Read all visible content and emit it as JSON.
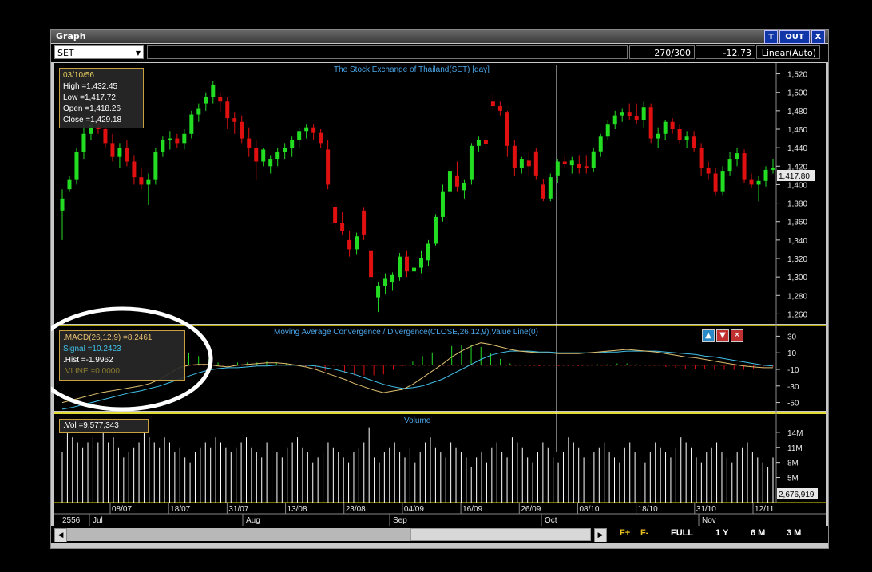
{
  "window": {
    "title": "Graph",
    "btn_t": "T",
    "btn_out": "OUT",
    "btn_x": "X"
  },
  "toolbar": {
    "symbol": "SET",
    "count": "270/300",
    "change": "-12.73",
    "scale": "Linear(Auto)"
  },
  "price_panel": {
    "title": "The Stock Exchange of Thailand(SET) [day]",
    "info": {
      "date": "03/10/56",
      "high": "High  =1,432.45",
      "low": "Low   =1,417.72",
      "open": "Open  =1,418.26",
      "close": "Close  =1,429.18"
    },
    "last_label": "1,417.80",
    "y_ticks": [
      "1,520",
      "1,500",
      "1,480",
      "1,460",
      "1,440",
      "1,420",
      "1,400",
      "1,380",
      "1,360",
      "1,340",
      "1,320",
      "1,300",
      "1,280",
      "1,260"
    ]
  },
  "macd_panel": {
    "title": "Moving Average Convergence / Divergence(CLOSE,26,12,9),Value Line(0)",
    "info": {
      "macd": ".MACD(26,12,9)   =8.2461",
      "signal": "Signal  =10.2423",
      "hist": ".Hist  =-1.9962",
      "vline": ".VLINE   =0.0000"
    },
    "y_ticks": [
      "30",
      "10",
      "-10",
      "-30",
      "-50"
    ]
  },
  "volume_panel": {
    "title": "Volume",
    "info": {
      "vol": ".Vol   =9,577,343"
    },
    "last_label": "2,676,919",
    "y_ticks": [
      "14M",
      "11M",
      "8M",
      "5M"
    ]
  },
  "x_axis": {
    "date_ticks": [
      "08/07",
      "18/07",
      "31/07",
      "13/08",
      "23/08",
      "04/09",
      "16/09",
      "26/09",
      "08/10",
      "18/10",
      "31/10",
      "12/11"
    ],
    "year": "2556",
    "month_ticks": [
      "Jul",
      "Aug",
      "Sep",
      "Oct",
      "Nov"
    ]
  },
  "bottom_bar": {
    "f_plus": "F+",
    "f_minus": "F-",
    "full": "FULL",
    "y1": "1 Y",
    "m6": "6 M",
    "m3": "3 M"
  },
  "colors": {
    "up": "#22dd22",
    "down": "#e01010",
    "macd_line": "#e0c070",
    "signal_line": "#40c0e8",
    "panel_border": "#e8e000",
    "accent": "#e8e000"
  },
  "chart_data": {
    "type": "candlestick",
    "title": "The Stock Exchange of Thailand(SET) [day]",
    "ylim": [
      1250,
      1530
    ],
    "candles": [
      [
        1372,
        1395,
        1340,
        1385
      ],
      [
        1395,
        1410,
        1392,
        1405
      ],
      [
        1405,
        1440,
        1400,
        1435
      ],
      [
        1435,
        1465,
        1428,
        1455
      ],
      [
        1455,
        1470,
        1448,
        1465
      ],
      [
        1465,
        1478,
        1455,
        1460
      ],
      [
        1460,
        1468,
        1440,
        1445
      ],
      [
        1445,
        1455,
        1425,
        1430
      ],
      [
        1430,
        1445,
        1418,
        1440
      ],
      [
        1440,
        1448,
        1420,
        1425
      ],
      [
        1425,
        1432,
        1400,
        1408
      ],
      [
        1408,
        1418,
        1395,
        1400
      ],
      [
        1400,
        1412,
        1378,
        1405
      ],
      [
        1405,
        1440,
        1400,
        1435
      ],
      [
        1435,
        1452,
        1430,
        1448
      ],
      [
        1448,
        1458,
        1438,
        1450
      ],
      [
        1450,
        1455,
        1440,
        1445
      ],
      [
        1445,
        1460,
        1438,
        1455
      ],
      [
        1455,
        1480,
        1450,
        1476
      ],
      [
        1476,
        1488,
        1468,
        1482
      ],
      [
        1488,
        1500,
        1480,
        1495
      ],
      [
        1495,
        1512,
        1488,
        1508
      ],
      [
        1495,
        1500,
        1478,
        1490
      ],
      [
        1490,
        1495,
        1460,
        1472
      ],
      [
        1472,
        1478,
        1455,
        1468
      ],
      [
        1468,
        1475,
        1445,
        1450
      ],
      [
        1450,
        1462,
        1430,
        1440
      ],
      [
        1440,
        1448,
        1405,
        1425
      ],
      [
        1425,
        1440,
        1420,
        1438
      ],
      [
        1420,
        1432,
        1412,
        1428
      ],
      [
        1428,
        1440,
        1420,
        1435
      ],
      [
        1435,
        1445,
        1428,
        1440
      ],
      [
        1440,
        1452,
        1430,
        1448
      ],
      [
        1448,
        1462,
        1440,
        1458
      ],
      [
        1458,
        1465,
        1450,
        1462
      ],
      [
        1462,
        1465,
        1448,
        1456
      ],
      [
        1456,
        1460,
        1440,
        1445
      ],
      [
        1438,
        1448,
        1395,
        1400
      ],
      [
        1376,
        1380,
        1352,
        1358
      ],
      [
        1358,
        1370,
        1345,
        1350
      ],
      [
        1340,
        1350,
        1322,
        1330
      ],
      [
        1330,
        1348,
        1324,
        1344
      ],
      [
        1372,
        1375,
        1340,
        1346
      ],
      [
        1328,
        1332,
        1290,
        1300
      ],
      [
        1278,
        1294,
        1262,
        1290
      ],
      [
        1290,
        1304,
        1282,
        1298
      ],
      [
        1294,
        1305,
        1285,
        1302
      ],
      [
        1300,
        1326,
        1296,
        1322
      ],
      [
        1322,
        1328,
        1300,
        1306
      ],
      [
        1306,
        1312,
        1298,
        1310
      ],
      [
        1310,
        1328,
        1304,
        1320
      ],
      [
        1318,
        1340,
        1312,
        1336
      ],
      [
        1336,
        1368,
        1334,
        1365
      ],
      [
        1365,
        1400,
        1360,
        1392
      ],
      [
        1392,
        1420,
        1388,
        1415
      ],
      [
        1410,
        1425,
        1392,
        1398
      ],
      [
        1394,
        1405,
        1385,
        1402
      ],
      [
        1405,
        1445,
        1400,
        1442
      ],
      [
        1442,
        1452,
        1436,
        1448
      ],
      [
        1448,
        1452,
        1440,
        1444
      ],
      [
        1490,
        1498,
        1480,
        1485
      ],
      [
        1485,
        1490,
        1475,
        1480
      ],
      [
        1478,
        1480,
        1430,
        1442
      ],
      [
        1442,
        1448,
        1410,
        1418
      ],
      [
        1418,
        1430,
        1412,
        1428
      ],
      [
        1426,
        1436,
        1410,
        1420
      ],
      [
        1436,
        1440,
        1405,
        1410
      ],
      [
        1400,
        1406,
        1382,
        1385
      ],
      [
        1385,
        1412,
        1382,
        1408
      ],
      [
        1410,
        1428,
        1402,
        1425
      ],
      [
        1425,
        1432,
        1418,
        1422
      ],
      [
        1421,
        1430,
        1412,
        1426
      ],
      [
        1422,
        1432,
        1412,
        1418
      ],
      [
        1420,
        1432,
        1412,
        1418
      ],
      [
        1418,
        1440,
        1414,
        1436
      ],
      [
        1436,
        1455,
        1430,
        1452
      ],
      [
        1452,
        1470,
        1448,
        1465
      ],
      [
        1465,
        1480,
        1460,
        1475
      ],
      [
        1475,
        1482,
        1468,
        1478
      ],
      [
        1478,
        1488,
        1470,
        1474
      ],
      [
        1474,
        1488,
        1466,
        1470
      ],
      [
        1470,
        1490,
        1462,
        1484
      ],
      [
        1484,
        1488,
        1445,
        1450
      ],
      [
        1450,
        1462,
        1440,
        1455
      ],
      [
        1455,
        1470,
        1448,
        1468
      ],
      [
        1468,
        1472,
        1455,
        1460
      ],
      [
        1460,
        1465,
        1445,
        1448
      ],
      [
        1448,
        1458,
        1440,
        1452
      ],
      [
        1452,
        1458,
        1435,
        1440
      ],
      [
        1440,
        1445,
        1410,
        1418
      ],
      [
        1418,
        1425,
        1405,
        1412
      ],
      [
        1412,
        1418,
        1388,
        1392
      ],
      [
        1392,
        1420,
        1388,
        1415
      ],
      [
        1415,
        1435,
        1410,
        1428
      ],
      [
        1428,
        1440,
        1420,
        1434
      ],
      [
        1434,
        1438,
        1402,
        1405
      ],
      [
        1405,
        1412,
        1396,
        1400
      ],
      [
        1400,
        1410,
        1382,
        1404
      ],
      [
        1404,
        1420,
        1398,
        1416
      ],
      [
        1416,
        1428,
        1412,
        1418
      ]
    ],
    "macd": [
      -50,
      -47,
      -44,
      -41,
      -38,
      -36,
      -34,
      -32,
      -30,
      -27,
      -22,
      -15,
      -8,
      -5,
      -4,
      -4,
      -6,
      -7,
      -5,
      -4,
      -3,
      -2,
      -2,
      -3,
      -5,
      -7,
      -10,
      -14,
      -18,
      -22,
      -27,
      -31,
      -35,
      -38,
      -36,
      -34,
      -28,
      -20,
      -12,
      -4,
      5,
      12,
      18,
      22,
      20,
      17,
      14,
      12,
      11,
      10,
      10,
      9,
      9,
      9,
      10,
      11,
      12,
      13,
      14,
      13,
      12,
      11,
      9,
      7,
      5,
      4,
      2,
      0,
      -2,
      -4,
      -6,
      -7,
      -8,
      -8
    ],
    "signal": [
      -58,
      -56,
      -53,
      -50,
      -47,
      -44,
      -41,
      -38,
      -36,
      -33,
      -30,
      -26,
      -22,
      -18,
      -14,
      -11,
      -9,
      -8,
      -8,
      -7,
      -6,
      -6,
      -5,
      -5,
      -5,
      -5,
      -6,
      -8,
      -10,
      -13,
      -16,
      -20,
      -24,
      -28,
      -31,
      -33,
      -32,
      -30,
      -26,
      -22,
      -16,
      -10,
      -4,
      2,
      7,
      10,
      12,
      12,
      12,
      11,
      11,
      10,
      10,
      10,
      10,
      10,
      11,
      11,
      12,
      12,
      12,
      12,
      11,
      10,
      9,
      8,
      6,
      5,
      3,
      1,
      -1,
      -3,
      -5,
      -6
    ],
    "volume_max": 17.0,
    "volume": [
      10,
      14,
      13,
      12,
      11,
      12,
      13,
      12,
      14,
      12,
      13,
      11,
      9,
      10,
      11,
      12,
      14,
      13,
      12,
      11,
      13,
      12,
      10,
      11,
      9,
      8,
      10,
      11,
      12,
      11,
      13,
      12,
      11,
      10,
      11,
      12,
      13,
      11,
      10,
      9,
      12,
      11,
      10,
      9,
      11,
      12,
      13,
      11,
      10,
      8,
      9,
      10,
      12,
      11,
      10,
      9,
      8,
      10,
      11,
      12,
      15,
      9,
      8,
      10,
      11,
      12,
      10,
      9,
      11,
      8,
      10,
      12,
      13,
      11,
      10,
      9,
      12,
      11,
      10,
      9,
      7,
      9,
      10,
      8,
      11,
      12,
      10,
      9,
      13,
      12,
      11,
      9,
      8,
      10,
      12,
      11,
      9,
      8,
      10,
      13,
      12,
      11,
      9,
      8,
      10,
      11,
      12,
      10,
      9,
      8,
      11,
      12,
      10,
      9,
      8,
      10,
      12,
      11,
      10,
      9,
      11,
      13,
      12,
      11,
      9,
      8,
      10,
      11,
      12,
      10,
      9,
      8,
      10,
      11,
      12,
      10,
      9,
      8,
      7,
      9
    ]
  }
}
